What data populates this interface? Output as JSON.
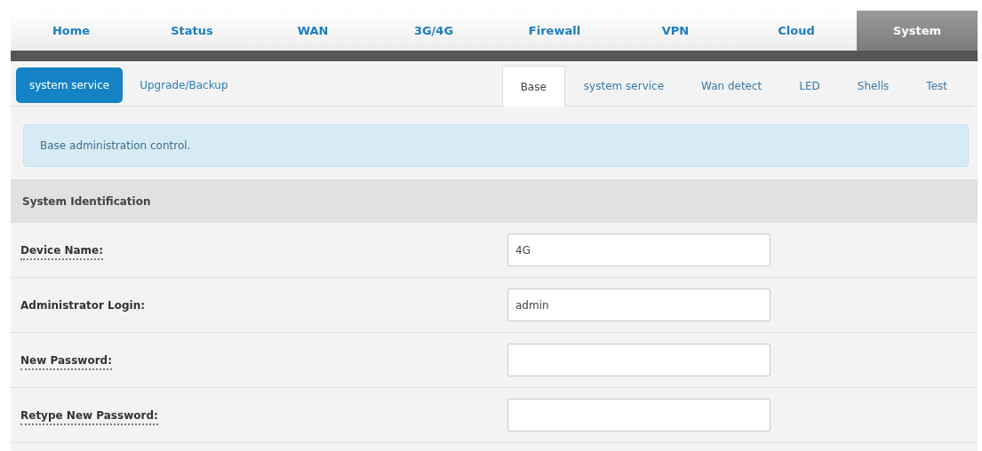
{
  "main_nav": [
    {
      "label": "Home",
      "selected": false
    },
    {
      "label": "Status",
      "selected": false
    },
    {
      "label": "WAN",
      "selected": false
    },
    {
      "label": "3G/4G",
      "selected": false
    },
    {
      "label": "Firewall",
      "selected": false
    },
    {
      "label": "VPN",
      "selected": false
    },
    {
      "label": "Cloud",
      "selected": false
    },
    {
      "label": "System",
      "selected": true
    }
  ],
  "sub_nav": [
    {
      "label": "system service",
      "selected": true
    },
    {
      "label": "Upgrade/Backup",
      "selected": false
    }
  ],
  "tabs": [
    {
      "label": "Base",
      "selected": true
    },
    {
      "label": "system service",
      "selected": false
    },
    {
      "label": "Wan detect",
      "selected": false
    },
    {
      "label": "LED",
      "selected": false
    },
    {
      "label": "Shells",
      "selected": false
    },
    {
      "label": "Test",
      "selected": false
    }
  ],
  "info": "Base administration control.",
  "section": {
    "title": "System Identification",
    "fields": [
      {
        "label": "Device Name:",
        "has_tooltip": true,
        "value": "4G"
      },
      {
        "label": "Administrator Login:",
        "has_tooltip": false,
        "value": "admin"
      },
      {
        "label": "New Password:",
        "has_tooltip": true
      },
      {
        "label": "Retype New Password:",
        "has_tooltip": true
      }
    ]
  }
}
